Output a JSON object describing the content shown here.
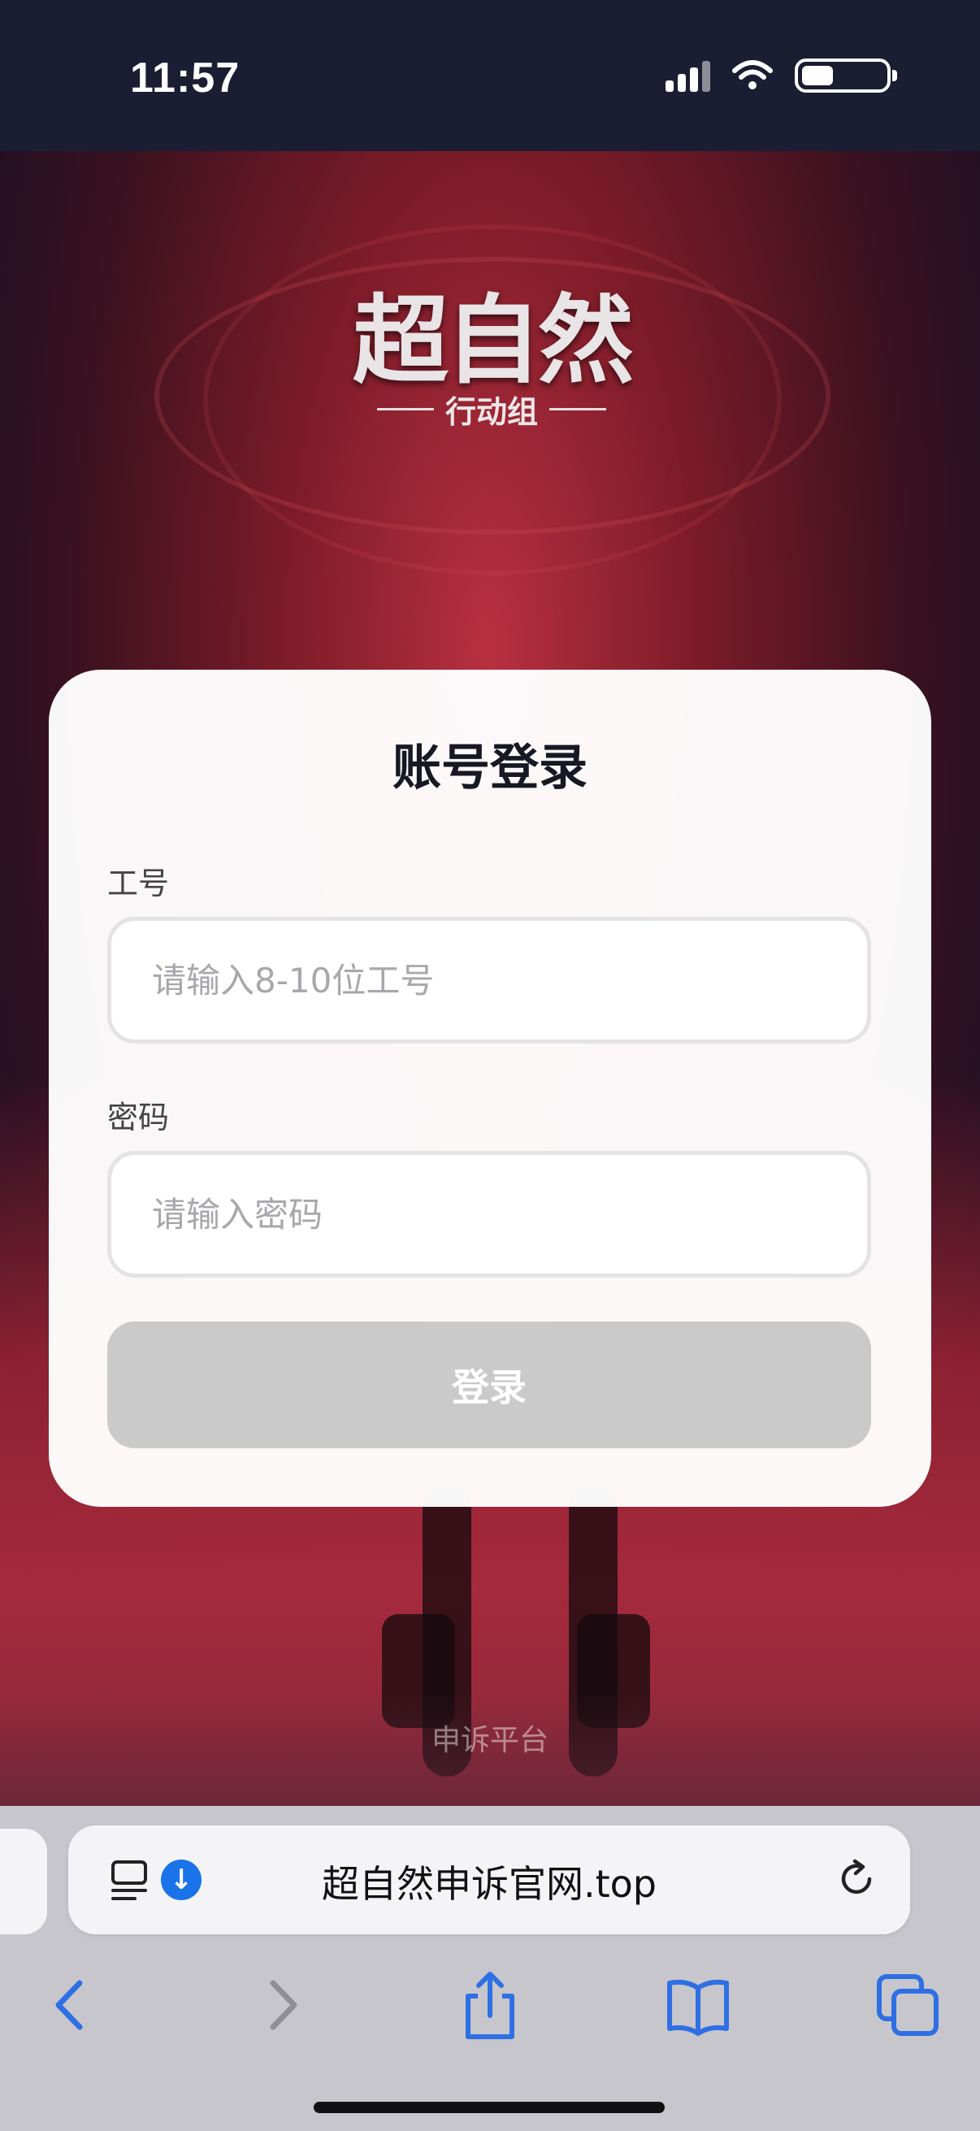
{
  "status_bar": {
    "time": "11:57"
  },
  "logo": {
    "title": "超自然",
    "subtitle": "行动组"
  },
  "login": {
    "title": "账号登录",
    "employee_id_label": "工号",
    "employee_id_placeholder": "请输入8-10位工号",
    "password_label": "密码",
    "password_placeholder": "请输入密码",
    "login_button": "登录"
  },
  "footer": {
    "appeal_link": "申诉平台"
  },
  "browser": {
    "url": "超自然申诉官网.top",
    "icons": [
      "reader-icon",
      "download-icon",
      "reload-icon",
      "back-icon",
      "forward-icon",
      "share-icon",
      "bookmarks-icon",
      "tabs-icon"
    ]
  },
  "colors": {
    "accent_blue": "#1a73e8",
    "button_disabled": "#cacaca",
    "hero_red": "#a52a3c"
  }
}
